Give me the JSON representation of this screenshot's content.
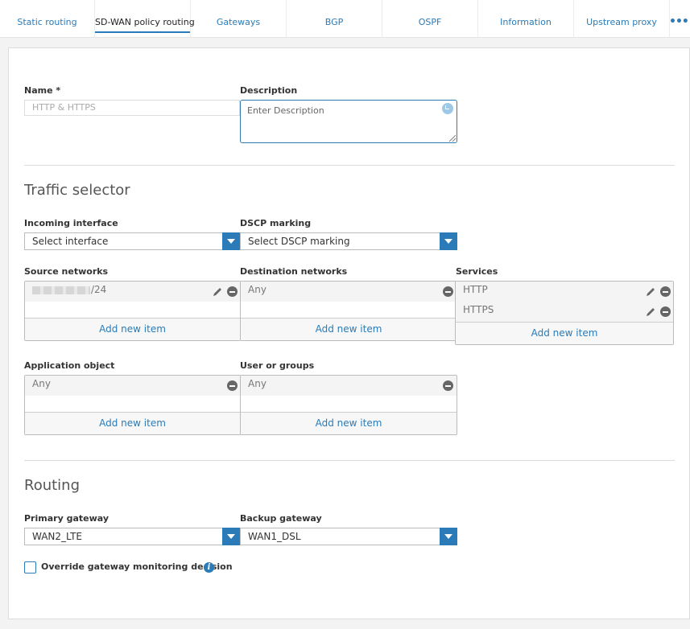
{
  "tabs": [
    {
      "label": "Static routing"
    },
    {
      "label": "SD-WAN policy routing"
    },
    {
      "label": "Gateways"
    },
    {
      "label": "BGP"
    },
    {
      "label": "OSPF"
    },
    {
      "label": "Information"
    },
    {
      "label": "Upstream proxy"
    }
  ],
  "active_tab": "SD-WAN policy routing",
  "more_icon": "•••",
  "form": {
    "name_label": "Name *",
    "name_value": "HTTP & HTTPS",
    "description_label": "Description",
    "description_placeholder": "Enter Description"
  },
  "traffic_selector": {
    "title": "Traffic selector",
    "incoming_interface_label": "Incoming interface",
    "incoming_interface_value": "Select interface",
    "dscp_label": "DSCP marking",
    "dscp_value": "Select DSCP marking",
    "source_networks_label": "Source networks",
    "source_networks_items": [
      "/24"
    ],
    "destination_networks_label": "Destination networks",
    "destination_networks_items": [
      "Any"
    ],
    "services_label": "Services",
    "services_items": [
      "HTTP",
      "HTTPS"
    ],
    "application_object_label": "Application object",
    "application_object_items": [
      "Any"
    ],
    "user_groups_label": "User or groups",
    "user_groups_items": [
      "Any"
    ],
    "add_new_item_label": "Add new item"
  },
  "routing": {
    "title": "Routing",
    "primary_gateway_label": "Primary gateway",
    "primary_gateway_value": "WAN2_LTE",
    "backup_gateway_label": "Backup gateway",
    "backup_gateway_value": "WAN1_DSL",
    "override_label": "Override gateway monitoring decision",
    "override_checked": false
  },
  "colors": {
    "accent": "#2a7bb8",
    "text": "#333333",
    "muted": "#777777"
  }
}
